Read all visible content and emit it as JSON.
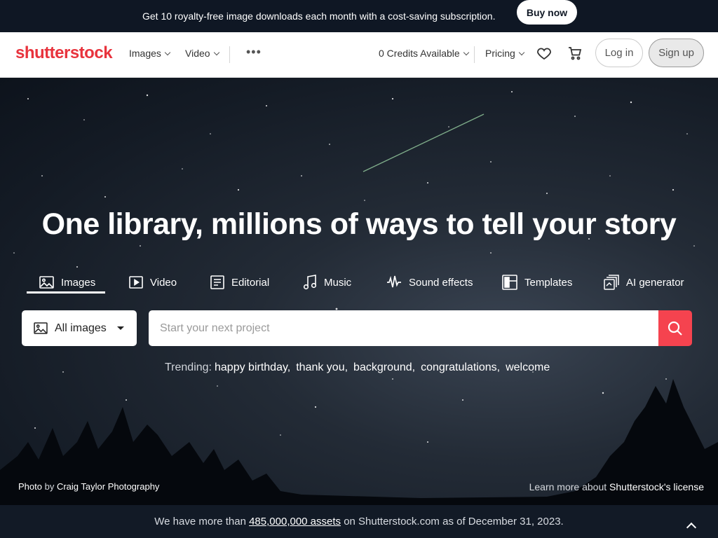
{
  "promo": {
    "text": "Get 10 royalty-free image downloads each month with a cost-saving subscription.",
    "button": "Buy now"
  },
  "header": {
    "logo": "shutterstock",
    "nav": {
      "images": "Images",
      "video": "Video",
      "more": "•••"
    },
    "credits": "0 Credits Available",
    "pricing": "Pricing",
    "login": "Log in",
    "signup": "Sign up"
  },
  "hero": {
    "title": "One library, millions of ways to tell your story",
    "tabs": [
      {
        "label": "Images",
        "icon": "image-icon"
      },
      {
        "label": "Video",
        "icon": "video-icon"
      },
      {
        "label": "Editorial",
        "icon": "editorial-icon"
      },
      {
        "label": "Music",
        "icon": "music-icon"
      },
      {
        "label": "Sound effects",
        "icon": "sound-wave-icon"
      },
      {
        "label": "Templates",
        "icon": "templates-icon"
      },
      {
        "label": "AI generator",
        "icon": "ai-generator-icon"
      }
    ],
    "search": {
      "type_selected": "All images",
      "placeholder": "Start your next project"
    },
    "trending": {
      "label": "Trending:",
      "items": [
        "happy birthday,",
        "thank you,",
        "background,",
        "congratulations,",
        "welcome"
      ]
    },
    "credit": {
      "prefix": "Photo",
      "by": "by",
      "author": "Craig Taylor Photography"
    },
    "license": {
      "prefix": "Learn more about",
      "link": "Shutterstock's license"
    }
  },
  "footer_bar": {
    "prefix": "We have more than",
    "count": "485,000,000 assets",
    "suffix": "on Shutterstock.com as of December 31, 2023."
  },
  "colors": {
    "brand": "#e8333d",
    "search_button": "#f5434f",
    "dark_bar": "#0f1724"
  }
}
